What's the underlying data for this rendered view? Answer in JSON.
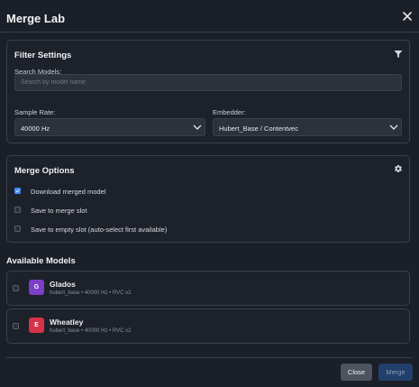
{
  "dialog": {
    "title": "Merge Lab"
  },
  "filter_settings": {
    "title": "Filter Settings",
    "search_label": "Search Models:",
    "search_placeholder": "Search by model name",
    "sample_rate_label": "Sample Rate:",
    "sample_rate_value": "40000 Hz",
    "embedder_label": "Embedder:",
    "embedder_value": "Hubert_Base / Contentvec"
  },
  "merge_options": {
    "title": "Merge Options",
    "options": [
      {
        "label": "Download merged model",
        "checked": true
      },
      {
        "label": "Save to merge slot",
        "checked": false
      },
      {
        "label": "Save to empty slot (auto-select first available)",
        "checked": false
      }
    ]
  },
  "available_models": {
    "title": "Available Models",
    "models": [
      {
        "initial": "G",
        "name": "Glados",
        "meta": "hubert_base • 40000 Hz • RVC v2",
        "color": "#7b3fc8",
        "checked": false
      },
      {
        "initial": "E",
        "name": "Wheatley",
        "meta": "hubert_base • 40000 Hz • RVC v2",
        "color": "#d6334a",
        "checked": false
      }
    ]
  },
  "footer": {
    "close_label": "Close",
    "merge_label": "Merge"
  },
  "colors": {
    "accent": "#3d8bfd",
    "background": "#1b1f27",
    "merge_disabled": "#22406c"
  },
  "icons": {
    "close": "close-icon",
    "filter": "filter-icon",
    "settings": "gear-icon",
    "dropdown": "chevron-down-icon"
  }
}
